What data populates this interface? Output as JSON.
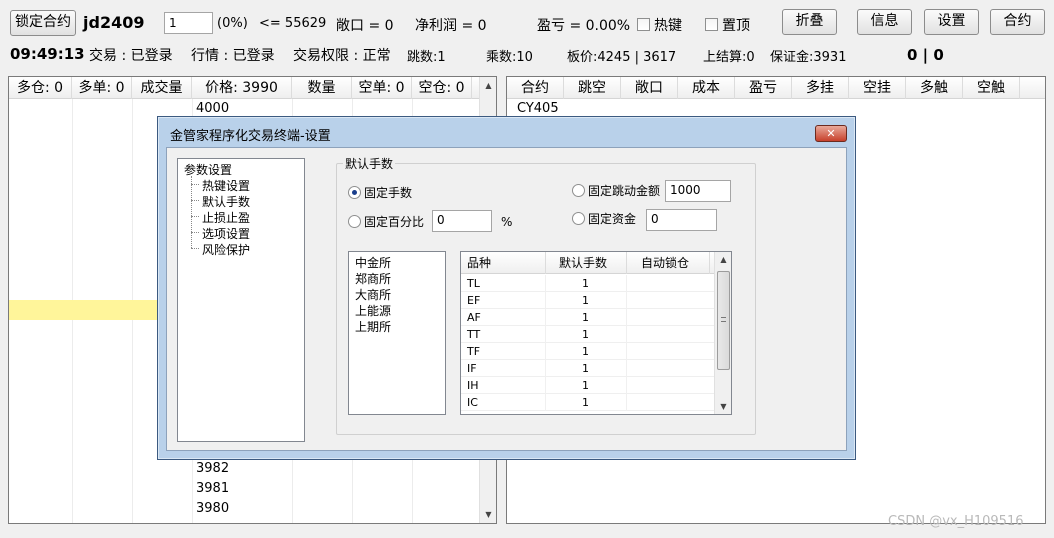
{
  "toolbar": {
    "lock_btn": "锁定合约",
    "contract": "jd2409",
    "qty_value": "1",
    "pct": "(0%)",
    "limit": "<= 55629",
    "open_pos": "敞口 = 0",
    "net_profit": "净利润 = 0",
    "pnl": "盈亏 = 0.00%",
    "hotkey_label": "热键",
    "pin_label": "置顶",
    "fold_btn": "折叠",
    "info_btn": "信息",
    "settings_btn": "设置",
    "contract_btn": "合约"
  },
  "status": {
    "time": "09:49:13",
    "trade": "交易 : 已登录",
    "market": "行情 : 已登录",
    "permission": "交易权限 : 正常",
    "tick": "跳数:1",
    "multiplier": "乘数:10",
    "board_price": "板价:4245 | 3617",
    "last_settle": "上结算:0",
    "margin": "保证金:3931",
    "counts": "0 | 0"
  },
  "left_table": {
    "columns": [
      "多仓: 0",
      "多单: 0",
      "成交量",
      "价格: 3990",
      "数量",
      "空单: 0",
      "空仓: 0"
    ],
    "top_price": "4000",
    "bottom_prices": [
      "3982",
      "3981",
      "3980"
    ]
  },
  "right_table": {
    "columns": [
      "合约",
      "跳空",
      "敞口",
      "成本",
      "盈亏",
      "多挂",
      "空挂",
      "多触",
      "空触"
    ],
    "first_row": "CY405"
  },
  "dialog": {
    "title": "金管家程序化交易终端-设置",
    "close": "✕",
    "tree": {
      "root": "参数设置",
      "children": [
        "热键设置",
        "默认手数",
        "止损止盈",
        "选项设置",
        "风险保护"
      ]
    },
    "group_title": "默认手数",
    "fixed_qty": "固定手数",
    "fixed_tick_amount": "固定跳动金额",
    "fixed_tick_amount_value": "1000",
    "fixed_pct": "固定百分比",
    "fixed_pct_value": "0",
    "pct_sign": "%",
    "fixed_capital": "固定资金",
    "fixed_capital_value": "0",
    "exchanges": [
      "中金所",
      "郑商所",
      "大商所",
      "上能源",
      "上期所"
    ],
    "table_headers": [
      "品种",
      "默认手数",
      "自动锁仓"
    ],
    "rows": [
      {
        "name": "TL",
        "qty": "1"
      },
      {
        "name": "EF",
        "qty": "1"
      },
      {
        "name": "AF",
        "qty": "1"
      },
      {
        "name": "TT",
        "qty": "1"
      },
      {
        "name": "TF",
        "qty": "1"
      },
      {
        "name": "IF",
        "qty": "1"
      },
      {
        "name": "IH",
        "qty": "1"
      },
      {
        "name": "IC",
        "qty": "1"
      }
    ]
  },
  "watermark": "CSDN @vx_H109516"
}
